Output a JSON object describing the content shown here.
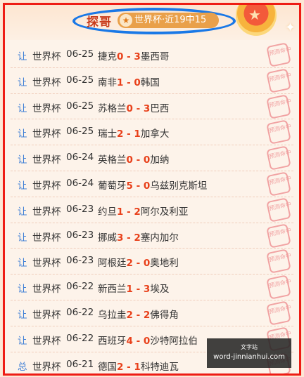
{
  "header": {
    "title": "探哥",
    "badge_icon": "★",
    "badge_text": "世界杯·近19中15"
  },
  "stamp_text": "预测命中",
  "matches": [
    {
      "tag": "让",
      "league": "世界杯",
      "date": "06-25",
      "home": "捷克",
      "home_score": "0",
      "sep": " - ",
      "away_score": "3",
      "away": "墨西哥"
    },
    {
      "tag": "让",
      "league": "世界杯",
      "date": "06-25",
      "home": "南非",
      "home_score": "1",
      "sep": " - ",
      "away_score": "0",
      "away": "韩国"
    },
    {
      "tag": "让",
      "league": "世界杯",
      "date": "06-25",
      "home": "苏格兰",
      "home_score": "0",
      "sep": " - ",
      "away_score": "3",
      "away": "巴西"
    },
    {
      "tag": "让",
      "league": "世界杯",
      "date": "06-25",
      "home": "瑞士",
      "home_score": "2",
      "sep": " - ",
      "away_score": "1",
      "away": "加拿大"
    },
    {
      "tag": "让",
      "league": "世界杯",
      "date": "06-24",
      "home": "英格兰",
      "home_score": "0",
      "sep": " - ",
      "away_score": "0",
      "away": "加纳"
    },
    {
      "tag": "让",
      "league": "世界杯",
      "date": "06-24",
      "home": "葡萄牙",
      "home_score": "5",
      "sep": " - ",
      "away_score": "0",
      "away": "乌兹别克斯坦"
    },
    {
      "tag": "让",
      "league": "世界杯",
      "date": "06-23",
      "home": "约旦",
      "home_score": "1",
      "sep": " - ",
      "away_score": "2",
      "away": "阿尔及利亚"
    },
    {
      "tag": "让",
      "league": "世界杯",
      "date": "06-23",
      "home": "挪威",
      "home_score": "3",
      "sep": " - ",
      "away_score": "2",
      "away": "塞内加尔"
    },
    {
      "tag": "让",
      "league": "世界杯",
      "date": "06-23",
      "home": "阿根廷",
      "home_score": "2",
      "sep": " - ",
      "away_score": "0",
      "away": "奥地利"
    },
    {
      "tag": "让",
      "league": "世界杯",
      "date": "06-22",
      "home": "新西兰",
      "home_score": "1",
      "sep": " - ",
      "away_score": "3",
      "away": "埃及"
    },
    {
      "tag": "让",
      "league": "世界杯",
      "date": "06-22",
      "home": "乌拉圭",
      "home_score": "2",
      "sep": " - ",
      "away_score": "2",
      "away": "佛得角"
    },
    {
      "tag": "让",
      "league": "世界杯",
      "date": "06-22",
      "home": "西班牙",
      "home_score": "4",
      "sep": " - ",
      "away_score": "0",
      "away": "沙特阿拉伯"
    },
    {
      "tag": "总",
      "league": "世界杯",
      "date": "06-21",
      "home": "德国",
      "home_score": "2",
      "sep": " - ",
      "away_score": "1",
      "away": "科特迪瓦"
    }
  ],
  "watermark": {
    "top": "文字站",
    "url": "word-jinnianhui.com"
  }
}
